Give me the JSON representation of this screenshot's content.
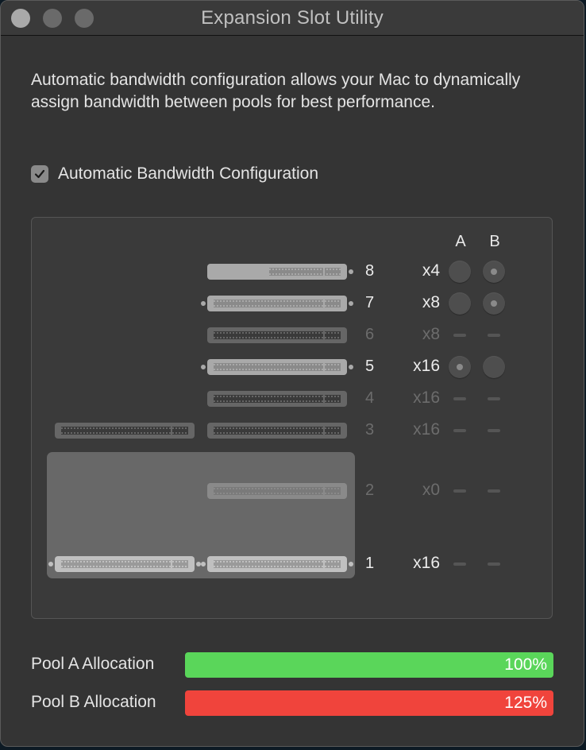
{
  "window": {
    "title": "Expansion Slot Utility",
    "traffic_lights": [
      "close",
      "minimize",
      "zoom"
    ]
  },
  "description": "Automatic bandwidth configuration allows your Mac to dynamically assign bandwidth between pools for best performance.",
  "auto_config": {
    "label": "Automatic Bandwidth Configuration",
    "checked": true
  },
  "slot_table": {
    "columns": {
      "a": "A",
      "b": "B"
    },
    "slots": [
      {
        "number": "8",
        "lanes": "x4",
        "active": true,
        "pool_a": "unselected",
        "pool_b": "selected"
      },
      {
        "number": "7",
        "lanes": "x8",
        "active": true,
        "pool_a": "unselected",
        "pool_b": "selected"
      },
      {
        "number": "6",
        "lanes": "x8",
        "active": false,
        "pool_a": "none",
        "pool_b": "none"
      },
      {
        "number": "5",
        "lanes": "x16",
        "active": true,
        "pool_a": "selected",
        "pool_b": "unselected"
      },
      {
        "number": "4",
        "lanes": "x16",
        "active": false,
        "pool_a": "none",
        "pool_b": "none"
      },
      {
        "number": "3",
        "lanes": "x16",
        "active": false,
        "pool_a": "none",
        "pool_b": "none"
      },
      {
        "number": "2",
        "lanes": "x0",
        "active": false,
        "pool_a": "none",
        "pool_b": "none"
      },
      {
        "number": "1",
        "lanes": "x16",
        "active": true,
        "pool_a": "none",
        "pool_b": "none"
      }
    ]
  },
  "pools": [
    {
      "label": "Pool A Allocation",
      "value": "100%",
      "percent": 100,
      "color": "#5ad65a"
    },
    {
      "label": "Pool B Allocation",
      "value": "125%",
      "percent": 125,
      "color": "#f0443c"
    }
  ],
  "colors": {
    "window_bg": "#343434",
    "panel_bg": "#3a3a3a",
    "pool_box_bg": "#686868",
    "text": "#e4e4e4",
    "dim_text": "#707070"
  }
}
